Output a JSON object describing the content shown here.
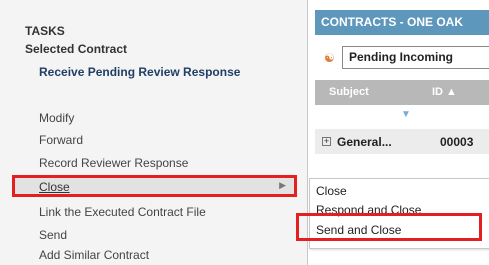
{
  "tasks_pane": {
    "title": "TASKS",
    "section": "Selected Contract",
    "primary_action": "Receive Pending Review Response",
    "items": [
      "Modify",
      "Forward",
      "Record Reviewer Response",
      "Close",
      "Link the Executed Contract File",
      "Send",
      "Add Similar Contract"
    ]
  },
  "contract_panel": {
    "header": "CONTRACTS - ONE OAK",
    "filter_value": "Pending Incoming",
    "columns": {
      "subject": "Subject",
      "id": "ID ▲"
    },
    "rows": [
      {
        "subject": "General...",
        "id": "00003"
      }
    ]
  },
  "flyout_menu": {
    "items": [
      "Close",
      "Respond and Close",
      "Send and Close"
    ]
  },
  "colors": {
    "highlight": "#e31f1f",
    "panel_header": "#5d97bb"
  }
}
